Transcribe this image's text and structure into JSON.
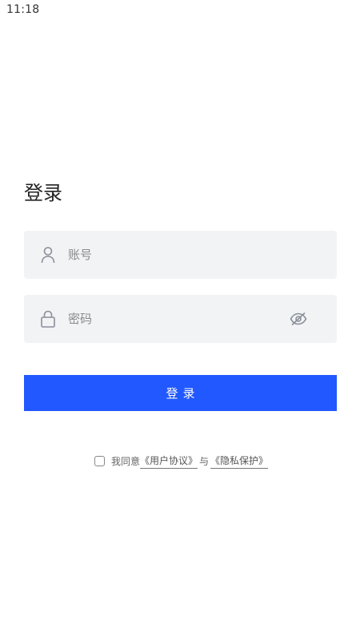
{
  "status_bar": {
    "time": "11:18"
  },
  "page": {
    "title": "登录"
  },
  "form": {
    "account": {
      "placeholder": "账号",
      "value": "",
      "icon": "user-icon"
    },
    "password": {
      "placeholder": "密码",
      "value": "",
      "icon": "lock-icon",
      "toggle_icon": "eye-icon"
    },
    "submit_label": "登录"
  },
  "agreement": {
    "prefix": "我同意",
    "user_agreement": "《用户协议》",
    "separator": "与",
    "privacy_policy": "《隐私保护》",
    "checked": false
  },
  "colors": {
    "primary": "#2258ff",
    "field_bg": "#f2f3f5",
    "placeholder": "#8a8a8a"
  }
}
